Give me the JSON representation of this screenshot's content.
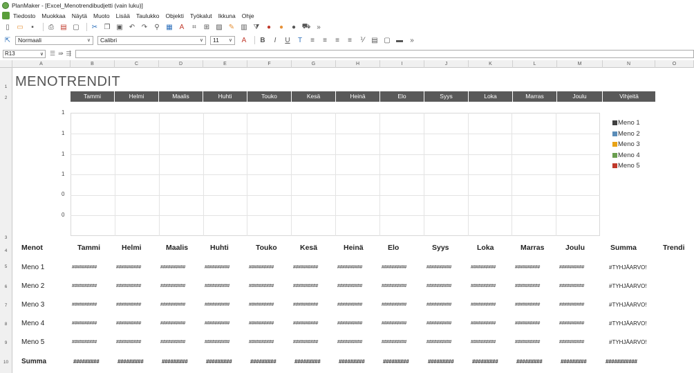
{
  "window": {
    "title": "PlanMaker - [Excel_Menotrendibudjetti (vain luku)]"
  },
  "menu": [
    "Tiedosto",
    "Muokkaa",
    "Näytä",
    "Muoto",
    "Lisää",
    "Taulukko",
    "Objekti",
    "Työkalut",
    "Ikkuna",
    "Ohje"
  ],
  "format": {
    "style": "Normaali",
    "font": "Calibri",
    "size": "11"
  },
  "formula": {
    "cell_ref": "R13",
    "content": ""
  },
  "columns": [
    "A",
    "B",
    "C",
    "D",
    "E",
    "F",
    "G",
    "H",
    "I",
    "J",
    "K",
    "L",
    "M",
    "N",
    "O"
  ],
  "rows": [
    "1",
    "2",
    "3",
    "4",
    "5",
    "6",
    "7",
    "8",
    "9",
    "10"
  ],
  "sheet": {
    "title": "MENOTRENDIT",
    "month_headers": [
      "Tammi",
      "Helmi",
      "Maalis",
      "Huhti",
      "Touko",
      "Kesä",
      "Heinä",
      "Elo",
      "Syys",
      "Loka",
      "Marras",
      "Joulu",
      "Vihjeitä"
    ],
    "table_headers": [
      "Menot",
      "Tammi",
      "Helmi",
      "Maalis",
      "Huhti",
      "Touko",
      "Kesä",
      "Heinä",
      "Elo",
      "Syys",
      "Loka",
      "Marras",
      "Joulu",
      "Summa",
      "Trendi"
    ],
    "rows": [
      {
        "label": "Meno 1",
        "sum": "#TYHJÄARVO!"
      },
      {
        "label": "Meno 2",
        "sum": "#TYHJÄARVO!"
      },
      {
        "label": "Meno 3",
        "sum": "#TYHJÄARVO!"
      },
      {
        "label": "Meno 4",
        "sum": "#TYHJÄARVO!"
      },
      {
        "label": "Meno 5",
        "sum": "#TYHJÄARVO!"
      }
    ],
    "cell_overflow": "##########",
    "total": {
      "label": "Summa",
      "cell": "#########",
      "sum": "###########"
    }
  },
  "chart_data": {
    "type": "line",
    "categories": [
      "Tammi",
      "Helmi",
      "Maalis",
      "Huhti",
      "Touko",
      "Kesä",
      "Heinä",
      "Elo",
      "Syys",
      "Loka",
      "Marras",
      "Joulu"
    ],
    "y_tick_labels": [
      "1",
      "1",
      "1",
      "1",
      "0",
      "0"
    ],
    "series": [
      {
        "name": "Meno 1",
        "color": "#404040",
        "values": []
      },
      {
        "name": "Meno 2",
        "color": "#5b8db8",
        "values": []
      },
      {
        "name": "Meno 3",
        "color": "#e8a317",
        "values": []
      },
      {
        "name": "Meno 4",
        "color": "#6a9e4f",
        "values": []
      },
      {
        "name": "Meno 5",
        "color": "#c0392b",
        "values": []
      }
    ],
    "grid": true,
    "legend": "right"
  }
}
